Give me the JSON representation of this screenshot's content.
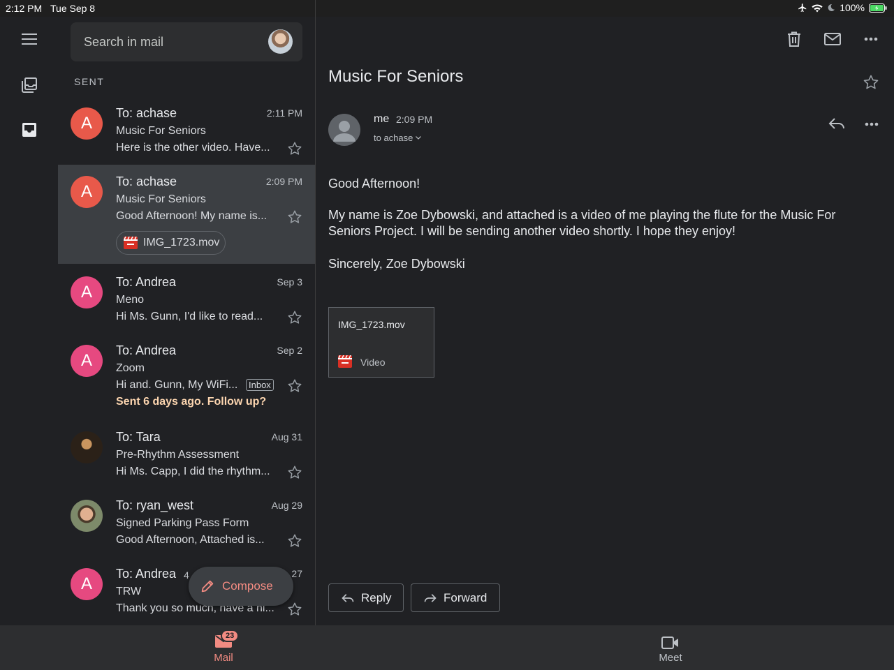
{
  "status_bar": {
    "time": "2:12 PM",
    "date": "Tue Sep 8",
    "battery": "100%"
  },
  "search": {
    "placeholder": "Search in mail"
  },
  "list": {
    "section_label": "SENT",
    "rows": [
      {
        "avatar_letter": "A",
        "avatar_color": "#e8594a",
        "to": "To: achase",
        "date": "2:11 PM",
        "subject": "Music For Seniors",
        "snippet": "Here is the other video. Have..."
      },
      {
        "avatar_letter": "A",
        "avatar_color": "#e8594a",
        "to": "To: achase",
        "date": "2:09 PM",
        "subject": "Music For Seniors",
        "snippet": "Good Afternoon! My name is...",
        "attachment": "IMG_1723.mov"
      },
      {
        "avatar_letter": "A",
        "avatar_color": "#e64980",
        "to": "To: Andrea",
        "date": "Sep 3",
        "subject": "Meno",
        "snippet": "Hi Ms. Gunn, I'd like to read..."
      },
      {
        "avatar_letter": "A",
        "avatar_color": "#e64980",
        "to": "To: Andrea",
        "date": "Sep 2",
        "subject": "Zoom",
        "snippet": "Hi and. Gunn, My WiFi...",
        "label": "Inbox",
        "nudge": "Sent 6 days ago. Follow up?"
      },
      {
        "avatar_letter": "",
        "avatar_color": "#5a4a3a",
        "to": "To: Tara",
        "date": "Aug 31",
        "subject": "Pre-Rhythm Assessment",
        "snippet": "Hi Ms. Capp, I did the rhythm..."
      },
      {
        "avatar_letter": "",
        "avatar_color": "#6a7a5a",
        "to": "To: ryan_west",
        "date": "Aug 29",
        "subject": "Signed Parking Pass Form",
        "snippet": "Good Afternoon, Attached is..."
      },
      {
        "avatar_letter": "A",
        "avatar_color": "#e64980",
        "to": "To: Andrea",
        "count": "4",
        "date": "27",
        "subject": "TRW",
        "snippet": "Thank you so much, have a ni..."
      }
    ]
  },
  "compose_label": "Compose",
  "message": {
    "subject": "Music For Seniors",
    "sender": "me",
    "time": "2:09 PM",
    "recipient": "to achase",
    "greeting": "Good Afternoon!",
    "body": "My name is Zoe Dybowski, and attached is a video of me playing the flute for the Music For Seniors Project. I will be sending another video shortly. I hope they enjoy!",
    "signoff": "Sincerely, Zoe Dybowski",
    "attachment": {
      "filename": "IMG_1723.mov",
      "type": "Video"
    },
    "reply_label": "Reply",
    "forward_label": "Forward"
  },
  "bottom_nav": {
    "mail_label": "Mail",
    "mail_badge": "23",
    "meet_label": "Meet"
  },
  "colors": {
    "accent": "#f28b82",
    "follow_up": "#fdd6b0",
    "attachment_red": "#d93025"
  }
}
